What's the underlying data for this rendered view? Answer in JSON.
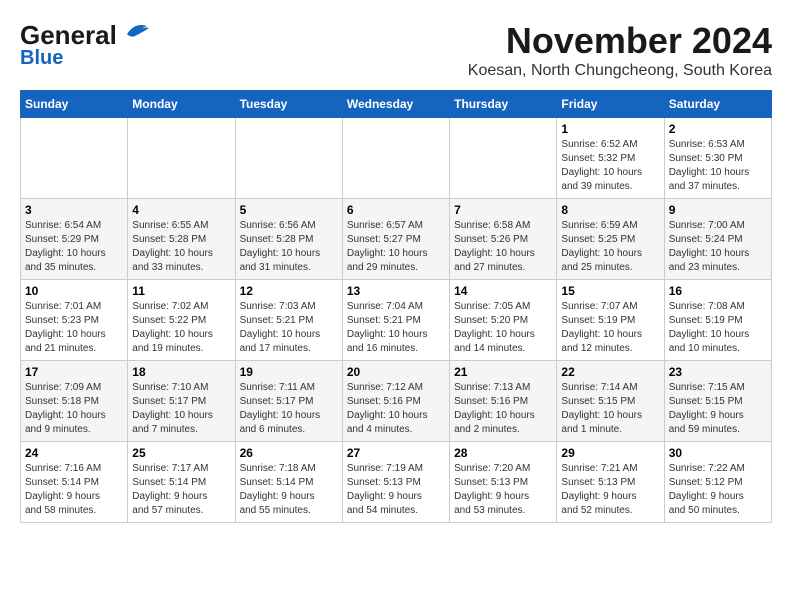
{
  "header": {
    "logo_general": "General",
    "logo_blue": "Blue",
    "month_title": "November 2024",
    "subtitle": "Koesan, North Chungcheong, South Korea"
  },
  "calendar": {
    "days_of_week": [
      "Sunday",
      "Monday",
      "Tuesday",
      "Wednesday",
      "Thursday",
      "Friday",
      "Saturday"
    ],
    "weeks": [
      [
        {
          "day": "",
          "info": ""
        },
        {
          "day": "",
          "info": ""
        },
        {
          "day": "",
          "info": ""
        },
        {
          "day": "",
          "info": ""
        },
        {
          "day": "",
          "info": ""
        },
        {
          "day": "1",
          "info": "Sunrise: 6:52 AM\nSunset: 5:32 PM\nDaylight: 10 hours\nand 39 minutes."
        },
        {
          "day": "2",
          "info": "Sunrise: 6:53 AM\nSunset: 5:30 PM\nDaylight: 10 hours\nand 37 minutes."
        }
      ],
      [
        {
          "day": "3",
          "info": "Sunrise: 6:54 AM\nSunset: 5:29 PM\nDaylight: 10 hours\nand 35 minutes."
        },
        {
          "day": "4",
          "info": "Sunrise: 6:55 AM\nSunset: 5:28 PM\nDaylight: 10 hours\nand 33 minutes."
        },
        {
          "day": "5",
          "info": "Sunrise: 6:56 AM\nSunset: 5:28 PM\nDaylight: 10 hours\nand 31 minutes."
        },
        {
          "day": "6",
          "info": "Sunrise: 6:57 AM\nSunset: 5:27 PM\nDaylight: 10 hours\nand 29 minutes."
        },
        {
          "day": "7",
          "info": "Sunrise: 6:58 AM\nSunset: 5:26 PM\nDaylight: 10 hours\nand 27 minutes."
        },
        {
          "day": "8",
          "info": "Sunrise: 6:59 AM\nSunset: 5:25 PM\nDaylight: 10 hours\nand 25 minutes."
        },
        {
          "day": "9",
          "info": "Sunrise: 7:00 AM\nSunset: 5:24 PM\nDaylight: 10 hours\nand 23 minutes."
        }
      ],
      [
        {
          "day": "10",
          "info": "Sunrise: 7:01 AM\nSunset: 5:23 PM\nDaylight: 10 hours\nand 21 minutes."
        },
        {
          "day": "11",
          "info": "Sunrise: 7:02 AM\nSunset: 5:22 PM\nDaylight: 10 hours\nand 19 minutes."
        },
        {
          "day": "12",
          "info": "Sunrise: 7:03 AM\nSunset: 5:21 PM\nDaylight: 10 hours\nand 17 minutes."
        },
        {
          "day": "13",
          "info": "Sunrise: 7:04 AM\nSunset: 5:21 PM\nDaylight: 10 hours\nand 16 minutes."
        },
        {
          "day": "14",
          "info": "Sunrise: 7:05 AM\nSunset: 5:20 PM\nDaylight: 10 hours\nand 14 minutes."
        },
        {
          "day": "15",
          "info": "Sunrise: 7:07 AM\nSunset: 5:19 PM\nDaylight: 10 hours\nand 12 minutes."
        },
        {
          "day": "16",
          "info": "Sunrise: 7:08 AM\nSunset: 5:19 PM\nDaylight: 10 hours\nand 10 minutes."
        }
      ],
      [
        {
          "day": "17",
          "info": "Sunrise: 7:09 AM\nSunset: 5:18 PM\nDaylight: 10 hours\nand 9 minutes."
        },
        {
          "day": "18",
          "info": "Sunrise: 7:10 AM\nSunset: 5:17 PM\nDaylight: 10 hours\nand 7 minutes."
        },
        {
          "day": "19",
          "info": "Sunrise: 7:11 AM\nSunset: 5:17 PM\nDaylight: 10 hours\nand 6 minutes."
        },
        {
          "day": "20",
          "info": "Sunrise: 7:12 AM\nSunset: 5:16 PM\nDaylight: 10 hours\nand 4 minutes."
        },
        {
          "day": "21",
          "info": "Sunrise: 7:13 AM\nSunset: 5:16 PM\nDaylight: 10 hours\nand 2 minutes."
        },
        {
          "day": "22",
          "info": "Sunrise: 7:14 AM\nSunset: 5:15 PM\nDaylight: 10 hours\nand 1 minute."
        },
        {
          "day": "23",
          "info": "Sunrise: 7:15 AM\nSunset: 5:15 PM\nDaylight: 9 hours\nand 59 minutes."
        }
      ],
      [
        {
          "day": "24",
          "info": "Sunrise: 7:16 AM\nSunset: 5:14 PM\nDaylight: 9 hours\nand 58 minutes."
        },
        {
          "day": "25",
          "info": "Sunrise: 7:17 AM\nSunset: 5:14 PM\nDaylight: 9 hours\nand 57 minutes."
        },
        {
          "day": "26",
          "info": "Sunrise: 7:18 AM\nSunset: 5:14 PM\nDaylight: 9 hours\nand 55 minutes."
        },
        {
          "day": "27",
          "info": "Sunrise: 7:19 AM\nSunset: 5:13 PM\nDaylight: 9 hours\nand 54 minutes."
        },
        {
          "day": "28",
          "info": "Sunrise: 7:20 AM\nSunset: 5:13 PM\nDaylight: 9 hours\nand 53 minutes."
        },
        {
          "day": "29",
          "info": "Sunrise: 7:21 AM\nSunset: 5:13 PM\nDaylight: 9 hours\nand 52 minutes."
        },
        {
          "day": "30",
          "info": "Sunrise: 7:22 AM\nSunset: 5:12 PM\nDaylight: 9 hours\nand 50 minutes."
        }
      ]
    ]
  }
}
